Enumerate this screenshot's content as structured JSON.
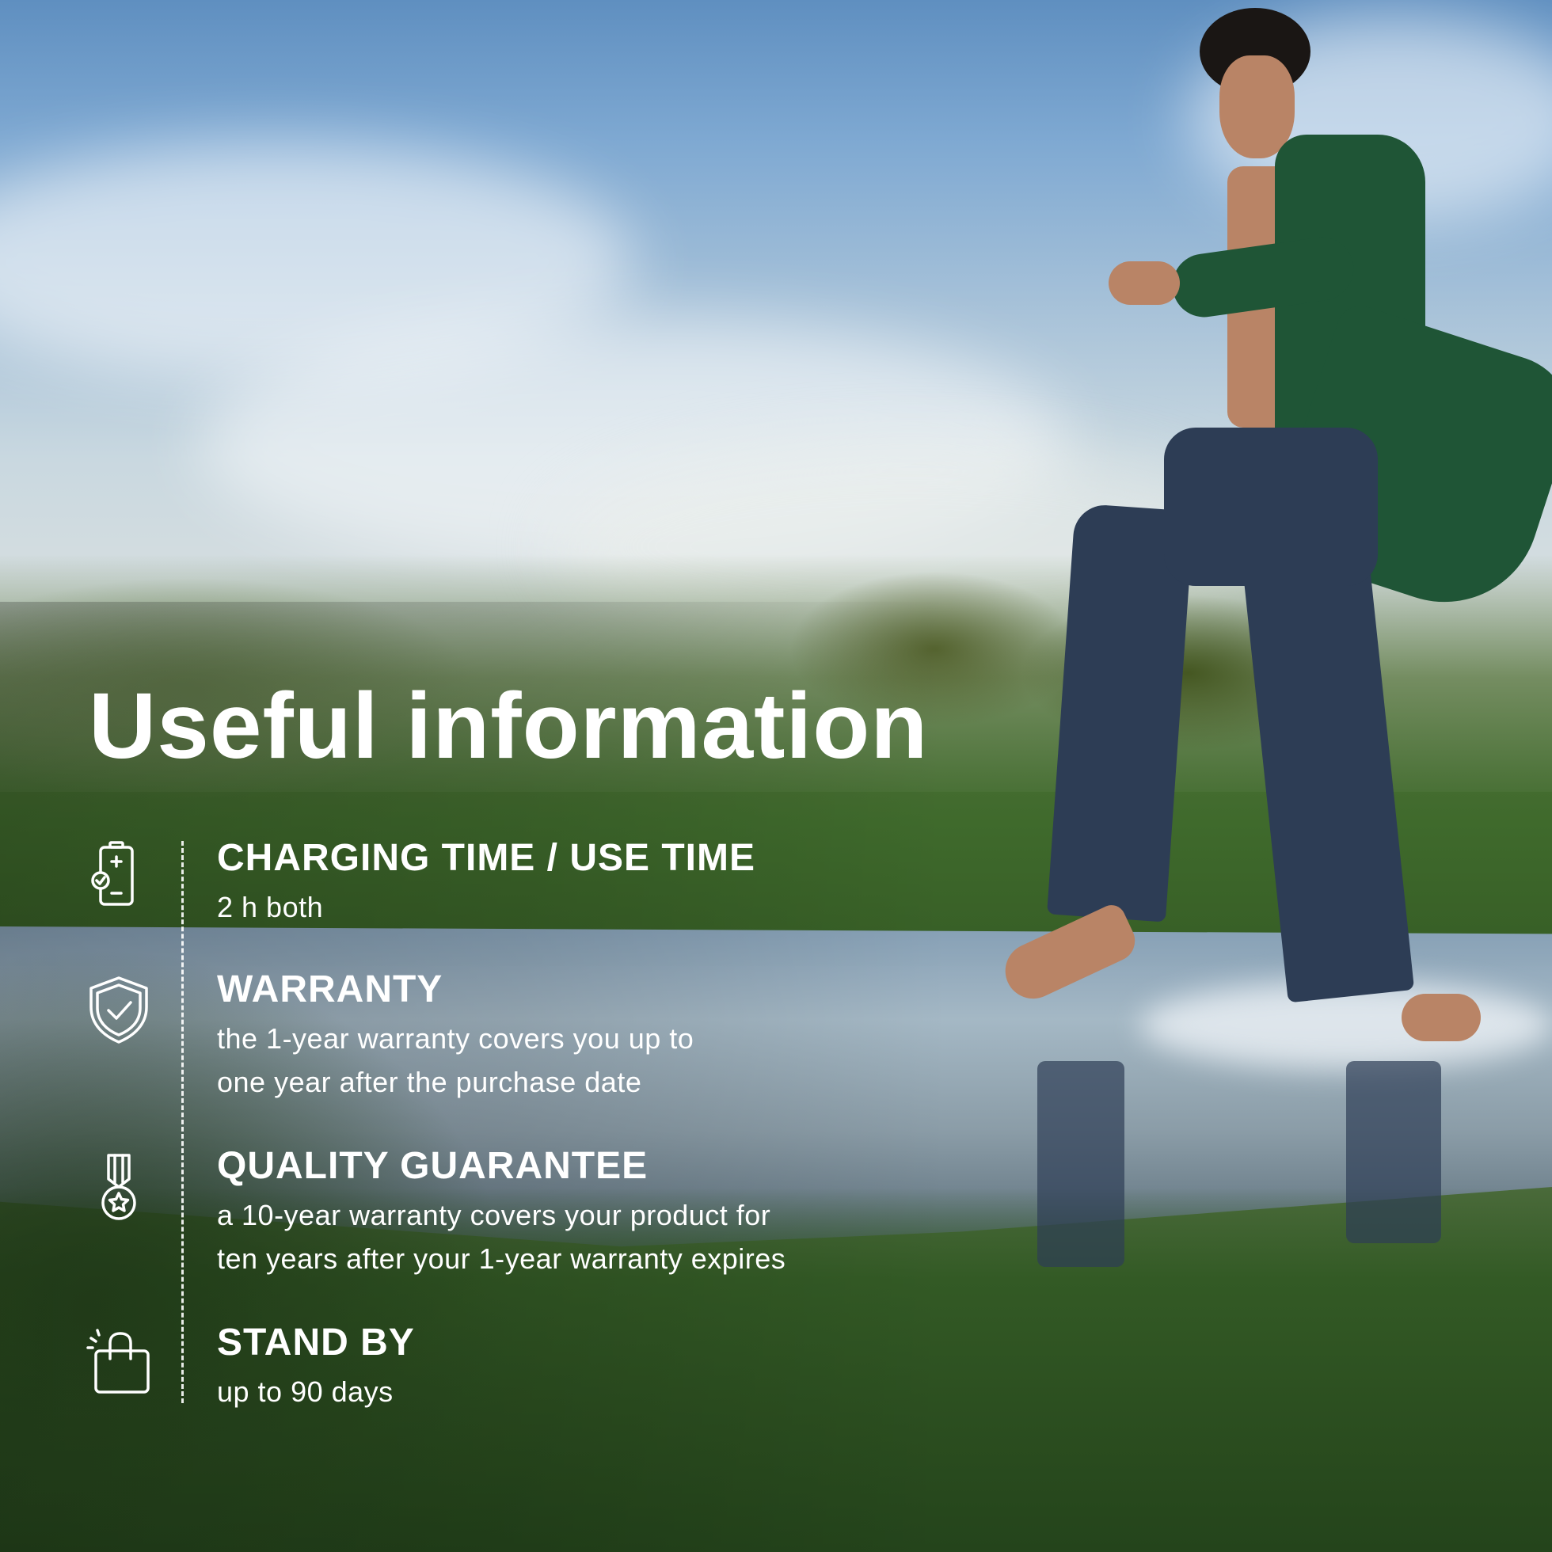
{
  "title": "Useful information",
  "items": [
    {
      "icon": "battery-charging-icon",
      "title": "CHARGING TIME / USE TIME",
      "desc_lines": [
        "2 h both"
      ]
    },
    {
      "icon": "shield-check-icon",
      "title": "WARRANTY",
      "desc_lines": [
        "the 1-year warranty covers you up to",
        "one year after the purchase date"
      ]
    },
    {
      "icon": "medal-star-icon",
      "title": "QUALITY GUARANTEE",
      "desc_lines": [
        "a 10-year warranty covers your product for",
        "ten years after your 1-year warranty expires"
      ]
    },
    {
      "icon": "shopping-bag-icon",
      "title": "STAND BY",
      "desc_lines": [
        "up to 90 days"
      ]
    }
  ],
  "colors": {
    "text": "#ffffff",
    "coat": "#1f5536",
    "jeans": "#2d3d55"
  }
}
